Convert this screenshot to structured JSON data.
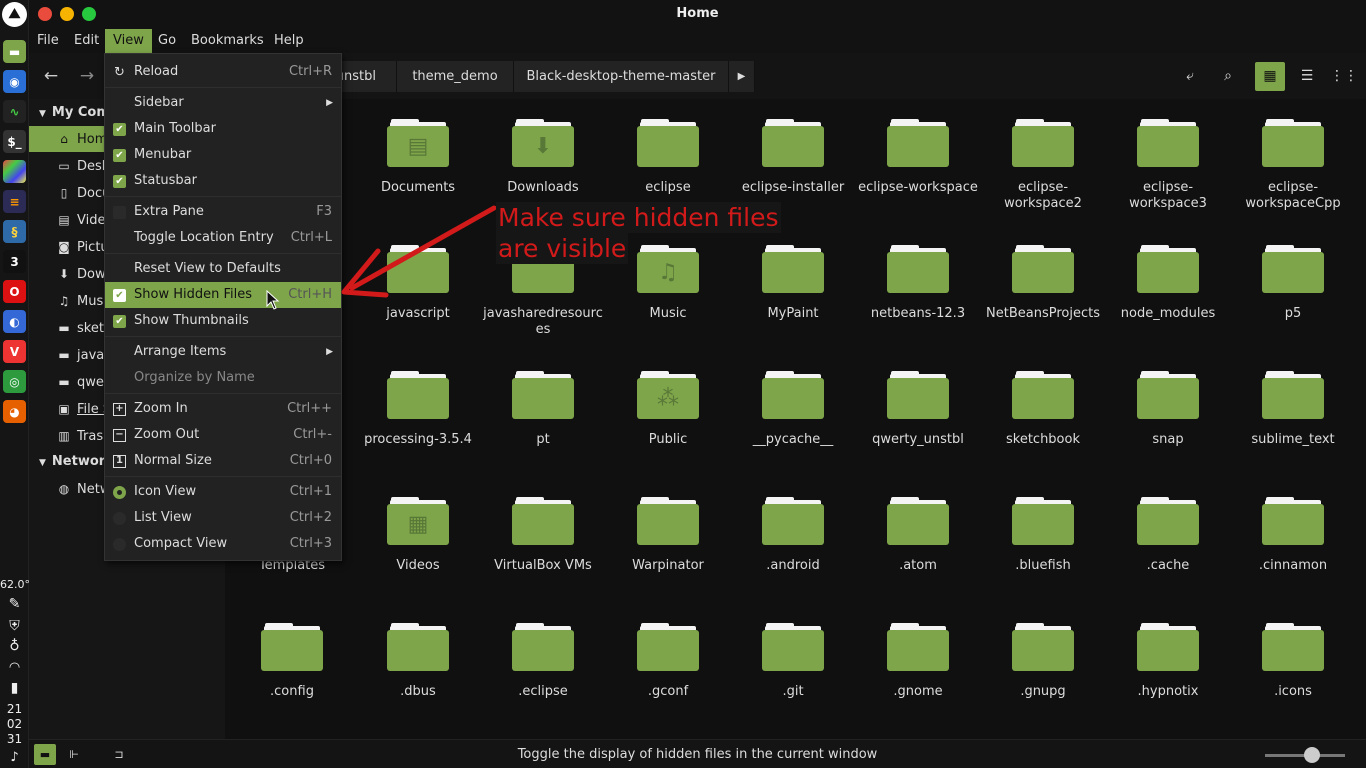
{
  "window": {
    "title": "Home"
  },
  "menubar": [
    "File",
    "Edit",
    "View",
    "Go",
    "Bookmarks",
    "Help"
  ],
  "toolbar": {
    "breadcrumbs": [
      "unstbl",
      "theme_demo",
      "Black-desktop-theme-master"
    ]
  },
  "sidebar": {
    "my_computer": "My Comp",
    "items": [
      {
        "label": "Home",
        "icon": "home-icon"
      },
      {
        "label": "Desk",
        "icon": "desktop-icon"
      },
      {
        "label": "Docu",
        "icon": "document-icon"
      },
      {
        "label": "Vide",
        "icon": "video-icon"
      },
      {
        "label": "Pictu",
        "icon": "camera-icon"
      },
      {
        "label": "Dow",
        "icon": "download-icon"
      },
      {
        "label": "Mus",
        "icon": "music-icon"
      },
      {
        "label": "sket",
        "icon": "folder-icon"
      },
      {
        "label": "java",
        "icon": "folder-icon"
      },
      {
        "label": "qwe",
        "icon": "folder-icon"
      },
      {
        "label": "File S",
        "icon": "drive-icon"
      },
      {
        "label": "Trasl",
        "icon": "trash-icon"
      }
    ],
    "network": "Network",
    "network_item": "Netw"
  },
  "view_menu": {
    "items": [
      {
        "label": "Reload",
        "accel": "Ctrl+R",
        "icon": "reload"
      },
      {
        "label": "Sidebar",
        "accel": "",
        "icon": "submenu"
      },
      {
        "label": "Main Toolbar",
        "accel": "",
        "icon": "check"
      },
      {
        "label": "Menubar",
        "accel": "",
        "icon": "check"
      },
      {
        "label": "Statusbar",
        "accel": "",
        "icon": "check"
      },
      {
        "label": "Extra Pane",
        "accel": "F3",
        "icon": "uncheck"
      },
      {
        "label": "Toggle Location Entry",
        "accel": "Ctrl+L",
        "icon": "none"
      },
      {
        "label": "Reset View to Defaults",
        "accel": "",
        "icon": "none"
      },
      {
        "label": "Show Hidden Files",
        "accel": "Ctrl+H",
        "icon": "check"
      },
      {
        "label": "Show Thumbnails",
        "accel": "",
        "icon": "check"
      },
      {
        "label": "Arrange Items",
        "accel": "",
        "icon": "submenu"
      },
      {
        "label": "Organize by Name",
        "accel": "",
        "icon": "none"
      },
      {
        "label": "Zoom In",
        "accel": "Ctrl++",
        "icon": "plus"
      },
      {
        "label": "Zoom Out",
        "accel": "Ctrl+-",
        "icon": "minus"
      },
      {
        "label": "Normal Size",
        "accel": "Ctrl+0",
        "icon": "one"
      },
      {
        "label": "Icon View",
        "accel": "Ctrl+1",
        "icon": "radio-on"
      },
      {
        "label": "List View",
        "accel": "Ctrl+2",
        "icon": "radio-off"
      },
      {
        "label": "Compact View",
        "accel": "Ctrl+3",
        "icon": "radio-off"
      }
    ]
  },
  "folders": [
    [
      "Documents",
      "Downloads",
      "eclipse",
      "eclipse-installer",
      "eclipse-workspace",
      "eclipse-\nworkspace2",
      "eclipse-\nworkspace3",
      "eclipse-\nworkspaceCpp"
    ],
    [
      "javascript",
      "javasharedresourc\nes",
      "Music",
      "MyPaint",
      "netbeans-12.3",
      "NetBeansProjects",
      "node_modules",
      "p5"
    ],
    [
      "processing-3.5.4",
      "pt",
      "Public",
      "__pycache__",
      "qwerty_unstbl",
      "sketchbook",
      "snap",
      "sublime_text"
    ],
    [
      "Templates",
      "Videos",
      "VirtualBox VMs",
      "Warpinator",
      ".android",
      ".atom",
      ".bluefish",
      ".cache",
      ".cinnamon"
    ],
    [
      ".config",
      ".dbus",
      ".eclipse",
      ".gconf",
      ".git",
      ".gnome",
      ".gnupg",
      ".hypnotix",
      ".icons"
    ]
  ],
  "annotation": {
    "line1": "Make sure hidden files",
    "line2": "are visible",
    "color": "#d21a1a"
  },
  "statusbar": {
    "text": "Toggle the display of hidden files in the current window"
  },
  "panel_tray": {
    "temperature": "62.0°",
    "clock": [
      "21",
      "02",
      "31"
    ]
  },
  "colors": {
    "accent": "#7ea54a",
    "background": "#101010"
  }
}
